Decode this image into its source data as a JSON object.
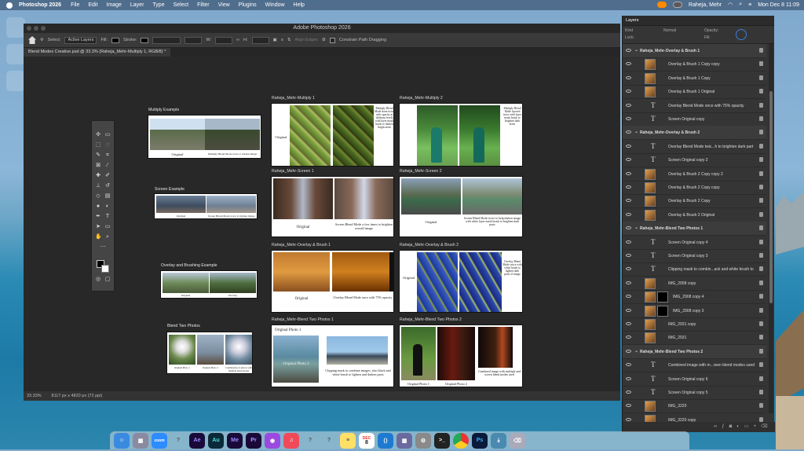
{
  "menubar": {
    "app_name": "Photoshop 2026",
    "items": [
      "File",
      "Edit",
      "Image",
      "Layer",
      "Type",
      "Select",
      "Filter",
      "View",
      "Plugins",
      "Window",
      "Help"
    ],
    "user": "Raheja, Mehr",
    "datetime": "Mon Dec 8  11:09"
  },
  "window": {
    "title": "Adobe Photoshop 2026",
    "tab": "Blend Modes Creative.psd @ 33.3% (Raheja_Mehr-Multiply 1, RGB/8) *"
  },
  "options": {
    "select_label": "Select:",
    "select_value": "Active Layers",
    "fill_label": "Fill:",
    "stroke_label": "Stroke:",
    "w_label": "W:",
    "h_label": "H:",
    "align_edges": "Align Edges",
    "constrain": "Constrain Path Dragging"
  },
  "status": {
    "zoom": "33.33%",
    "doc": "8117 px x 4820 px (72 ppi)"
  },
  "artboards": {
    "left_labels": [
      "Multiply Example",
      "Screen Example",
      "Overlay and Brushing Example",
      "Blend Two Photos"
    ],
    "thumb_caps": {
      "multiply": [
        "Original",
        "Multiply Blend Mode twice to darken image"
      ],
      "screen": [
        "Original",
        "Screen Blend Mode twice to lighten image"
      ],
      "overlay": [
        "Original",
        "Overlay"
      ],
      "blend": [
        "Original Photo 1",
        "Original Photo 2",
        "Combination of photos with multiple blend modes"
      ]
    },
    "titles": [
      "Raheja_Mehr-Multiply 1",
      "Raheja_Mehr-Multiply 2",
      "Raheja_Mehr-Screen 1",
      "Raheja_Mehr-Screen 2",
      "Raheja_Mehr-Overlay & Brush 1",
      "Raheja_Mehr-Overlay & Brush 2",
      "Raheja_Mehr-Blend Two Photos 1",
      "Raheja_Mehr-Blend Two Photos 2"
    ],
    "captions": {
      "m1_left": "Original",
      "m1_right": "Multiply Blend Mode done twice with opacity at different levels with layer mask brush to darken bright areas",
      "m2_right": "Multiply Blend Mode layered twice with layer mask brush to brighten dark areas",
      "s1_left": "Original",
      "s1_right": "Screen Blend Mode a few times to brighten overall image",
      "s2_left": "Original",
      "s2_right": "Screen Blend Mode twice to help darken image with white layer mask brush to brighten dark parts",
      "o1_left": "Original",
      "o1_right": "Overlay Blend Mode once with 75% opacity",
      "o2_left": "Original",
      "o2_right": "Overlay Blend Mode twice with white brush to lighten dark parts of image",
      "b1_top": "Original Photo 1",
      "b1_mid": "Original Photo 2",
      "b1_bottom": "Clipping mask to combine images, also black and white brush to lighten and darken parts",
      "b2_left": "Original Photo 1",
      "b2_mid": "Original Photo 2",
      "b2_right": "Combined image with multiply and screen blend modes used"
    }
  },
  "layers": {
    "tab": "Layers",
    "kind": "Kind",
    "mode": "Normal",
    "opacity": "Opacity:",
    "fill": "Fill:",
    "lock": "Lock:",
    "rows": [
      {
        "name": "Raheja_Mehr-Overlay & Brush 1",
        "type": "group"
      },
      {
        "name": "Overlay & Brush 1 Copy copy",
        "type": "image"
      },
      {
        "name": "Overlay & Brush 1 Copy",
        "type": "image"
      },
      {
        "name": "Overlay & Brush 1 Original",
        "type": "image"
      },
      {
        "name": "Overlay Blend Mode once with 75% opacity",
        "type": "text"
      },
      {
        "name": "Screen Original copy",
        "type": "text"
      },
      {
        "name": "Raheja_Mehr-Overlay & Brush 2",
        "type": "group"
      },
      {
        "name": "Overlay Blend Mode twic...h to brighten dark part",
        "type": "text"
      },
      {
        "name": "Screen Original copy 2",
        "type": "text"
      },
      {
        "name": "Overlay & Brush 2 Copy copy 2",
        "type": "image"
      },
      {
        "name": "Overlay & Brush 2 Copy copy",
        "type": "image"
      },
      {
        "name": "Overlay & Brush 2 Copy",
        "type": "image"
      },
      {
        "name": "Overlay & Brush 2 Original",
        "type": "image"
      },
      {
        "name": "Raheja_Mehr-Blend Two Photos 1",
        "type": "group"
      },
      {
        "name": "Screen Original copy 4",
        "type": "text"
      },
      {
        "name": "Screen Original copy 3",
        "type": "text"
      },
      {
        "name": "Clipping mask to combin...ack and white brush to",
        "type": "text"
      },
      {
        "name": "IMG_2908 copy",
        "type": "image"
      },
      {
        "name": "IMG_2908 copy 4",
        "type": "masked"
      },
      {
        "name": "IMG_2908 copy 3",
        "type": "masked"
      },
      {
        "name": "IMG_2931 copy",
        "type": "image"
      },
      {
        "name": "IMG_2931",
        "type": "image"
      },
      {
        "name": "Raheja_Mehr-Blend Two Photos 2",
        "type": "group"
      },
      {
        "name": "Combined image with m...reen blend modes used",
        "type": "text"
      },
      {
        "name": "Screen Original copy 6",
        "type": "text"
      },
      {
        "name": "Screen Original copy 5",
        "type": "text"
      },
      {
        "name": "IMG_3220",
        "type": "image"
      },
      {
        "name": "IMG_3220 copy",
        "type": "image"
      }
    ]
  },
  "dock": {
    "apps": [
      "Finder",
      "Launchpad",
      "Zoom",
      "?",
      "Ae",
      "Au",
      "Me",
      "Pr",
      "Podcasts",
      "Music",
      "?",
      "?",
      "Notes",
      "Calendar",
      "VS Code",
      "Shortcuts",
      "Settings",
      "Terminal",
      "Chrome",
      "Ps",
      "Downloads",
      "Trash"
    ],
    "calendar_month": "DEC",
    "calendar_day": "8"
  },
  "colors": {
    "ps_bg": "#323232",
    "canvas": "#282828",
    "accent": "#3d7be0",
    "menubar": "#2d4660"
  }
}
